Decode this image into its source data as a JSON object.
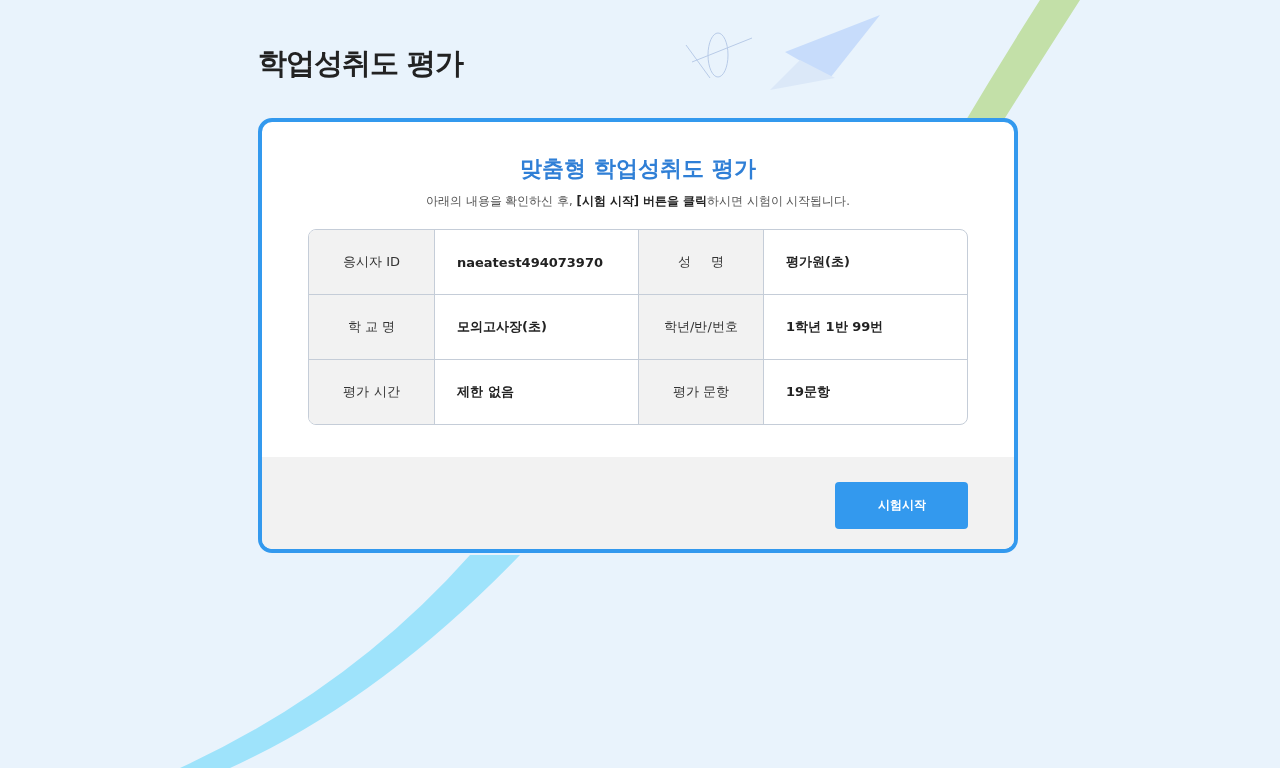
{
  "page_title": "학업성취도 평가",
  "card": {
    "title": "맞춤형 학업성취도 평가",
    "instruction": "아래의 내용을 확인하신 후, **[시험 시작] 버튼을 클릭**하시면 시험이 시작됩니다."
  },
  "info_rows": [
    {
      "cells": [
        {
          "label": "응시자 ID",
          "value": "naeatest494073970"
        },
        {
          "label": "성     명",
          "value": "평가원(초)"
        }
      ]
    },
    {
      "cells": [
        {
          "label": "학 교 명",
          "value": "모의고사장(초)"
        },
        {
          "label": "학년/반/번호",
          "value": "1학년 1반 99번"
        }
      ]
    },
    {
      "cells": [
        {
          "label": "평가 시간",
          "value": "제한 없음"
        },
        {
          "label": "평가 문항",
          "value": "19문항"
        }
      ]
    }
  ],
  "start_button": "시험시작"
}
